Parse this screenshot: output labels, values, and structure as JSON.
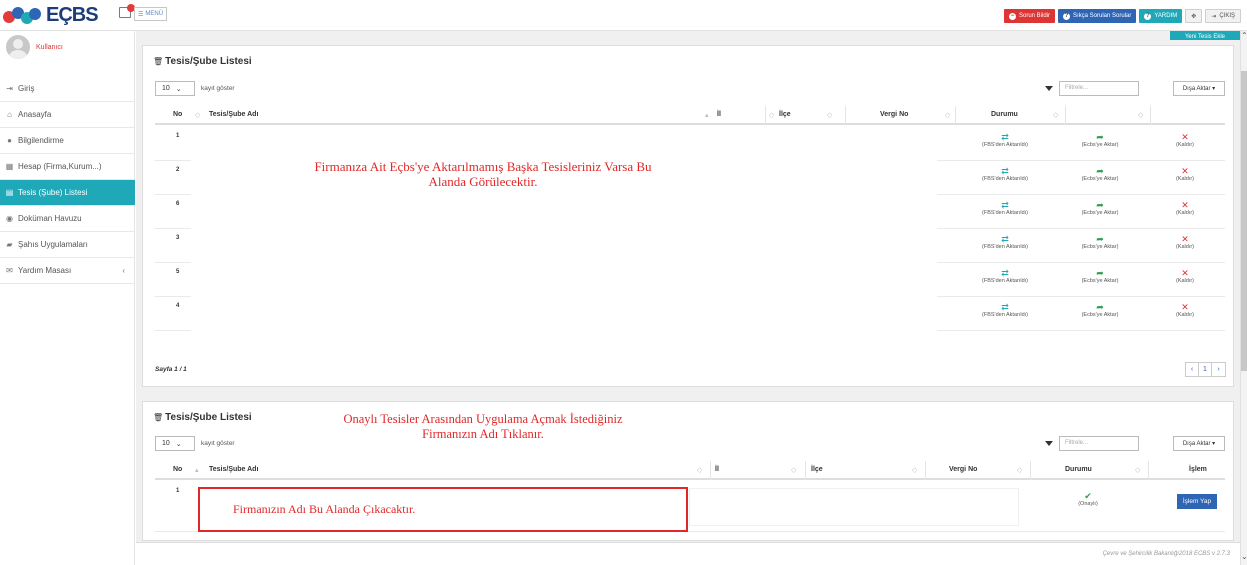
{
  "app": {
    "brand": "EÇBS",
    "menu_label": "MENÜ"
  },
  "header": {
    "buttons": [
      {
        "label": "Sorun Bildir",
        "icon": "minus-circle-icon"
      },
      {
        "label": "Sıkça Sorulan Sorular",
        "icon": "question-icon"
      },
      {
        "label": "YARDIM",
        "icon": "question-icon"
      }
    ],
    "exit_label": "ÇIKIŞ"
  },
  "user": {
    "name": "Kullanıcı"
  },
  "sidebar": {
    "items": [
      {
        "label": "Giriş",
        "icon": "login-icon"
      },
      {
        "label": "Anasayfa",
        "icon": "home-icon"
      },
      {
        "label": "Bilgilendirme",
        "icon": "info-icon"
      },
      {
        "label": "Hesap (Firma,Kurum...)",
        "icon": "building-icon"
      },
      {
        "label": "Tesis (Şube) Listesi",
        "icon": "list-icon",
        "active": true
      },
      {
        "label": "Doküman Havuzu",
        "icon": "users-icon"
      },
      {
        "label": "Şahıs Uygulamaları",
        "icon": "cars-icon"
      },
      {
        "label": "Yardım Masası",
        "icon": "envelope-icon"
      }
    ]
  },
  "panel1": {
    "new_label": "Yeni Tesis Ekle",
    "title": "Tesis/Şube Listesi",
    "length": "10",
    "length_text": "kayıt göster",
    "filter_placeholder": "Filtrele...",
    "export_label": "Dışa Aktar ▾",
    "columns": [
      "No",
      "Tesis/Şube Adı",
      "İl",
      "İlçe",
      "Vergi No",
      "Durumu"
    ],
    "rows": [
      "1",
      "2",
      "6",
      "3",
      "5",
      "4"
    ],
    "actions": {
      "fbs": "(FBS'den Aktarıldı)",
      "ecbs": "(Ecbs'ye Aktar)",
      "remove": "(Kaldır)"
    },
    "annotation": "Firmanıza Ait Eçbs'ye Aktarılmamış Başka Tesisleriniz Varsa Bu Alanda Görülecektir.",
    "page_info": "Sayfa 1 / 1",
    "page": "1"
  },
  "panel2": {
    "title": "Tesis/Şube Listesi",
    "length": "10",
    "length_text": "kayıt göster",
    "filter_placeholder": "Filtrele...",
    "export_label": "Dışa Aktar ▾",
    "columns": [
      "No",
      "Tesis/Şube Adı",
      "İl",
      "İlçe",
      "Vergi No",
      "Durumu",
      "İşlem"
    ],
    "row_no": "1",
    "status": "(Onaylı)",
    "action": "İşlem Yap",
    "annotation_top": "Onaylı Tesisler Arasından Uygulama Açmak İstediğiniz Firmanızın Adı Tıklanır.",
    "annotation_box": "Firmanızın Adı Bu Alanda Çıkacaktır."
  },
  "footer": {
    "text": "Çevre ve Şehircilik Bakanlığı2018  ECBS v 2.7.3"
  },
  "colors": {
    "accent": "#1fa8b8",
    "danger": "#dd3434",
    "primary": "#2f65b5",
    "annotation": "#e12828"
  }
}
